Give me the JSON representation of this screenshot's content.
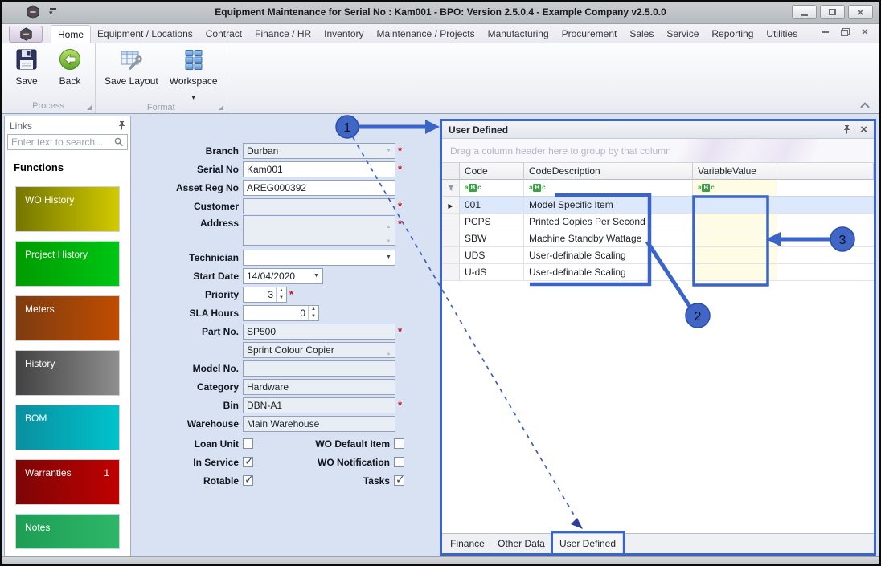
{
  "window": {
    "title": "Equipment Maintenance for Serial No : Kam001 - BPO: Version 2.5.0.4 - Example Company v2.5.0.0"
  },
  "ribbon": {
    "tabs": [
      "Home",
      "Equipment / Locations",
      "Contract",
      "Finance / HR",
      "Inventory",
      "Maintenance / Projects",
      "Manufacturing",
      "Procurement",
      "Sales",
      "Service",
      "Reporting",
      "Utilities"
    ],
    "active_tab": "Home",
    "groups": [
      {
        "label": "Process",
        "buttons": [
          {
            "label": "Save"
          },
          {
            "label": "Back"
          }
        ]
      },
      {
        "label": "Format",
        "buttons": [
          {
            "label": "Save Layout"
          },
          {
            "label": "Workspace",
            "has_dropdown": true
          }
        ]
      }
    ]
  },
  "links_panel": {
    "title": "Links",
    "search_placeholder": "Enter text to search...",
    "section_title": "Functions",
    "buttons": [
      {
        "label": "WO History",
        "badge": "",
        "from": "#747600",
        "to": "#d2ca00"
      },
      {
        "label": "Project History",
        "badge": "",
        "from": "#009b00",
        "to": "#00c614"
      },
      {
        "label": "Meters",
        "badge": "",
        "from": "#7e3c10",
        "to": "#bf4d00"
      },
      {
        "label": "History",
        "badge": "",
        "from": "#424242",
        "to": "#8e8e8e"
      },
      {
        "label": "BOM",
        "badge": "",
        "from": "#0a8fa0",
        "to": "#00c3cc"
      },
      {
        "label": "Warranties",
        "badge": "1",
        "from": "#7d0606",
        "to": "#c00000"
      },
      {
        "label": "Notes",
        "badge": "",
        "from": "#1e9e55",
        "to": "#2eb668"
      }
    ]
  },
  "form": {
    "required_marker": "*",
    "fields": {
      "branch": {
        "label": "Branch",
        "value": "Durban"
      },
      "serial_no": {
        "label": "Serial No",
        "value": "Kam001"
      },
      "asset_reg_no": {
        "label": "Asset Reg No",
        "value": "AREG000392"
      },
      "customer": {
        "label": "Customer",
        "value": ""
      },
      "address": {
        "label": "Address",
        "value": ""
      },
      "technician": {
        "label": "Technician",
        "value": ""
      },
      "start_date": {
        "label": "Start Date",
        "value": "14/04/2020"
      },
      "priority": {
        "label": "Priority",
        "value": "3"
      },
      "sla_hours": {
        "label": "SLA Hours",
        "value": "0"
      },
      "part_no": {
        "label": "Part No.",
        "value": "SP500"
      },
      "part_description": {
        "label": "",
        "value": "Sprint Colour Copier"
      },
      "model_no": {
        "label": "Model No.",
        "value": ""
      },
      "category": {
        "label": "Category",
        "value": "Hardware"
      },
      "bin": {
        "label": "Bin",
        "value": "DBN-A1"
      },
      "warehouse": {
        "label": "Warehouse",
        "value": "Main Warehouse"
      }
    },
    "checkboxes": {
      "loan_unit": {
        "label": "Loan Unit",
        "checked": false
      },
      "wo_default_item": {
        "label": "WO Default Item",
        "checked": false
      },
      "in_service": {
        "label": "In Service",
        "checked": true
      },
      "wo_notification": {
        "label": "WO Notification",
        "checked": false
      },
      "rotable": {
        "label": "Rotable",
        "checked": true
      },
      "tasks": {
        "label": "Tasks",
        "checked": true
      }
    }
  },
  "user_defined_panel": {
    "title": "User Defined",
    "group_by_hint": "Drag a column header here to group by that column",
    "filter_icon_text": {
      "a": "a",
      "b": "B",
      "c": "c"
    },
    "columns": [
      "Code",
      "CodeDescription",
      "VariableValue"
    ],
    "rows": [
      {
        "code": "001",
        "description": "Model Specific Item",
        "value": "",
        "selected": true
      },
      {
        "code": "PCPS",
        "description": "Printed Copies Per Second",
        "value": ""
      },
      {
        "code": "SBW",
        "description": "Machine Standby Wattage",
        "value": ""
      },
      {
        "code": "UDS",
        "description": "User-definable Scaling",
        "value": ""
      },
      {
        "code": "U-dS",
        "description": "User-definable Scaling",
        "value": ""
      }
    ],
    "tabs": [
      "Finance",
      "Other Data",
      "User Defined"
    ],
    "active_tab": "User Defined"
  },
  "callouts": {
    "labels": [
      "1",
      "2",
      "3"
    ]
  },
  "colors": {
    "callout_blue": "#3a64c8",
    "selection": "#dce8fb",
    "value_cell": "#fffce6"
  }
}
